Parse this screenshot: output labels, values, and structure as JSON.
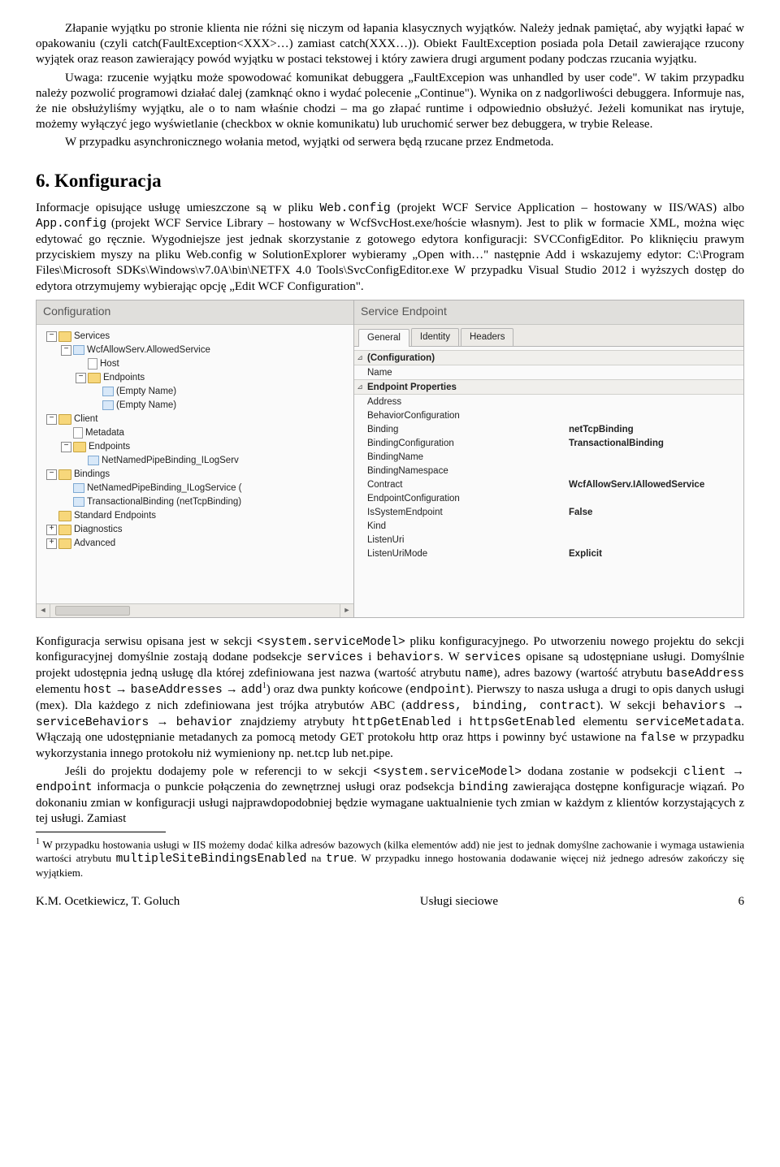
{
  "para1": "Złapanie wyjątku po stronie klienta nie różni się niczym od łapania klasycznych wyjątków. Należy jednak pamiętać, aby wyjątki łapać w opakowaniu (czyli catch(FaultException<XXX>…) zamiast catch(XXX…)). Obiekt FaultException posiada pola Detail zawierające rzucony wyjątek oraz reason zawierający powód wyjątku w postaci tekstowej i który zawiera drugi argument podany podczas rzucania wyjątku.",
  "para2": "Uwaga: rzucenie wyjątku może spowodować komunikat debuggera „FaultExcepion was unhandled by user code\". W takim przypadku należy pozwolić programowi działać dalej (zamknąć okno i wydać polecenie „Continue\"). Wynika on z nadgorliwości debuggera. Informuje nas, że nie obsłużyliśmy wyjątku, ale o to nam właśnie chodzi – ma go złapać runtime i odpowiednio obsłużyć. Jeżeli komunikat nas irytuje, możemy wyłączyć jego wyświetlanie (checkbox w oknie komunikatu) lub uruchomić serwer bez debuggera, w trybie Release.",
  "para3": "W przypadku asynchronicznego wołania metod, wyjątki od serwera będą rzucane przez Endmetoda.",
  "h2": "6. Konfiguracja",
  "intro1a": "Informacje opisujące usługę umieszczone są w pliku ",
  "intro1code1": "Web.config",
  "intro1b": " (projekt WCF Service Application – hostowany w IIS/WAS) albo ",
  "intro1code2": "App.config",
  "intro1c": " (projekt WCF Service Library – hostowany w WcfSvcHost.exe/hoście własnym). Jest to plik w formacie XML, można więc edytować go ręcznie. Wygodniejsze jest jednak skorzystanie z gotowego edytora konfiguracji: SVCConfigEditor. Po kliknięciu prawym przyciskiem myszy na pliku Web.config w SolutionExplorer wybieramy „Open with…\" następnie Add i wskazujemy edytor: C:\\Program Files\\Microsoft SDKs\\Windows\\v7.0A\\bin\\NETFX 4.0 Tools\\SvcConfigEditor.exe W przypadku Visual Studio 2012 i wyższych dostęp do edytora otrzymujemy wybierając opcję „Edit WCF Configuration\".",
  "shot": {
    "left_title": "Configuration",
    "right_title": "Service Endpoint",
    "tree": [
      {
        "d": 0,
        "t": "−",
        "i": "folder",
        "l": "Services"
      },
      {
        "d": 1,
        "t": "−",
        "i": "node",
        "l": "WcfAllowServ.AllowedService"
      },
      {
        "d": 2,
        "t": "",
        "i": "doc",
        "l": "Host"
      },
      {
        "d": 2,
        "t": "−",
        "i": "folder",
        "l": "Endpoints"
      },
      {
        "d": 3,
        "t": "",
        "i": "node",
        "l": "(Empty Name)"
      },
      {
        "d": 3,
        "t": "",
        "i": "node",
        "l": "(Empty Name)"
      },
      {
        "d": 0,
        "t": "−",
        "i": "folder",
        "l": "Client"
      },
      {
        "d": 1,
        "t": "",
        "i": "doc",
        "l": "Metadata"
      },
      {
        "d": 1,
        "t": "−",
        "i": "folder",
        "l": "Endpoints"
      },
      {
        "d": 2,
        "t": "",
        "i": "node",
        "l": "NetNamedPipeBinding_ILogServ"
      },
      {
        "d": 0,
        "t": "−",
        "i": "folder",
        "l": "Bindings"
      },
      {
        "d": 1,
        "t": "",
        "i": "node",
        "l": "NetNamedPipeBinding_ILogService ("
      },
      {
        "d": 1,
        "t": "",
        "i": "node",
        "l": "TransactionalBinding (netTcpBinding)"
      },
      {
        "d": 0,
        "t": "",
        "i": "folder",
        "l": "Standard Endpoints"
      },
      {
        "d": 0,
        "t": "+",
        "i": "folder",
        "l": "Diagnostics"
      },
      {
        "d": 0,
        "t": "+",
        "i": "folder",
        "l": "Advanced"
      }
    ],
    "tabs": [
      "General",
      "Identity",
      "Headers"
    ],
    "grid": [
      {
        "cat": true,
        "c": "⊿",
        "n": "(Configuration)",
        "v": ""
      },
      {
        "cat": false,
        "c": "",
        "n": "Name",
        "v": ""
      },
      {
        "cat": true,
        "c": "⊿",
        "n": "Endpoint Properties",
        "v": ""
      },
      {
        "cat": false,
        "c": "",
        "n": "Address",
        "v": ""
      },
      {
        "cat": false,
        "c": "",
        "n": "BehaviorConfiguration",
        "v": ""
      },
      {
        "cat": false,
        "c": "",
        "n": "Binding",
        "v": "netTcpBinding",
        "b": true
      },
      {
        "cat": false,
        "c": "",
        "n": "BindingConfiguration",
        "v": "TransactionalBinding",
        "b": true
      },
      {
        "cat": false,
        "c": "",
        "n": "BindingName",
        "v": ""
      },
      {
        "cat": false,
        "c": "",
        "n": "BindingNamespace",
        "v": ""
      },
      {
        "cat": false,
        "c": "",
        "n": "Contract",
        "v": "WcfAllowServ.IAllowedService",
        "b": true
      },
      {
        "cat": false,
        "c": "",
        "n": "EndpointConfiguration",
        "v": ""
      },
      {
        "cat": false,
        "c": "",
        "n": "IsSystemEndpoint",
        "v": "False",
        "b": true
      },
      {
        "cat": false,
        "c": "",
        "n": "Kind",
        "v": ""
      },
      {
        "cat": false,
        "c": "",
        "n": "ListenUri",
        "v": ""
      },
      {
        "cat": false,
        "c": "",
        "n": "ListenUriMode",
        "v": "Explicit",
        "b": true
      }
    ]
  },
  "post": {
    "t1": "Konfiguracja serwisu opisana jest w sekcji ",
    "c1": "<system.serviceModel>",
    "t2": " pliku konfiguracyjnego. Po utworzeniu nowego projektu do sekcji konfiguracyjnej domyślnie zostają dodane podsekcje ",
    "c2": "services",
    "t3": " i ",
    "c3": "behaviors",
    "t4": ". W ",
    "c4": "services",
    "t5": " opisane są udostępniane usługi. Domyślnie projekt udostępnia jedną usługę dla której zdefiniowana jest nazwa (wartość atrybutu ",
    "c5": "name",
    "t6": "), adres bazowy (wartość atrybutu ",
    "c6": "baseAddress",
    "t7": " elementu ",
    "c7": "host",
    "t8": " → ",
    "c8": "baseAddresses",
    "t9": " → ",
    "c9": "add",
    "sup1": "1",
    "t10": ") oraz dwa punkty końcowe (",
    "c10": "endpoint",
    "t11": "). Pierwszy to nasza usługa a drugi to opis danych usługi (mex). Dla każdego z nich zdefiniowana jest trójka atrybutów ABC (",
    "c11": "address, binding, contract",
    "t12": "). W sekcji ",
    "c12": "behaviors",
    "t13": " → ",
    "c13": "serviceBehaviors",
    "t14": " → ",
    "c14": "behavior",
    "t15": " znajdziemy atrybuty ",
    "c15": "httpGetEnabled",
    "t16": " i ",
    "c16": "httpsGetEnabled",
    "t17": " elementu ",
    "c17": "serviceMetadata",
    "t18": ". Włączają one udostępnianie metadanych za pomocą metody GET protokołu http oraz https i powinny być ustawione na ",
    "c18": "false",
    "t19": " w przypadku wykorzystania innego protokołu niż wymieniony np. net.tcp lub net.pipe."
  },
  "post2": {
    "t1": "Jeśli do projektu dodajemy pole w referencji to w sekcji ",
    "c1": "<system.serviceModel>",
    "t2": " dodana zostanie w podsekcji ",
    "c2": "client",
    "t3": " → ",
    "c3": "endpoint",
    "t4": " informacja o punkcie połączenia do zewnętrznej usługi oraz podsekcja ",
    "c4": "binding",
    "t5": " zawierająca dostępne konfiguracje wiązań. Po dokonaniu zmian w konfiguracji usługi najprawdopodobniej będzie wymagane uaktualnienie tych zmian w każdym z klientów korzystających z tej usługi. Zamiast"
  },
  "footnote": {
    "t1": "W przypadku hostowania usługi w IIS możemy dodać kilka adresów bazowych (kilka elementów add) nie jest to jednak domyślne zachowanie i wymaga ustawienia wartości atrybutu ",
    "c1": "multipleSiteBindingsEnabled",
    "t2": " na ",
    "c2": "true",
    "t3": ". W przypadku innego hostowania dodawanie więcej niż jednego adresów zakończy się wyjątkiem."
  },
  "footer": {
    "left": "K.M. Ocetkiewicz, T. Goluch",
    "mid": "Usługi sieciowe",
    "right": "6"
  }
}
